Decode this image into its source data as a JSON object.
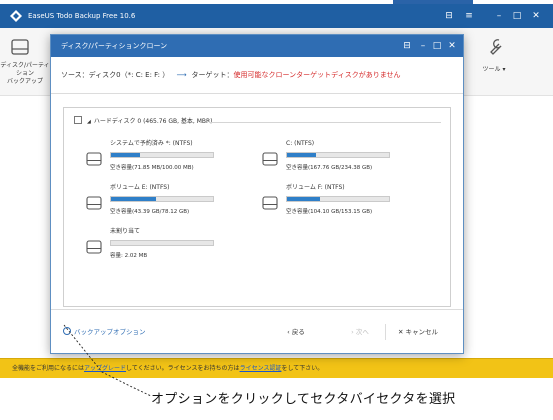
{
  "app": {
    "title": "EaseUS Todo Backup Free 10.6",
    "toolbar": {
      "clone_label": "ディスク/パーティション\nバックアップ",
      "tools_label": "ツール ▾"
    }
  },
  "dialog": {
    "title": "ディスク/パーティションクローン",
    "source_label": "ソース：",
    "source_value": "ディスク0（*: C: E: F: ）",
    "target_label": "ターゲット：",
    "target_warning": "使用可能なクローンターゲットディスクがありません",
    "disk": {
      "header": "ハードディスク 0 (465.76 GB, 基本, MBR)",
      "partitions": [
        {
          "name": "システムで予約済み *: (NTFS)",
          "size": "空き容量(71.85 MB/100.00 MB)",
          "used_fraction": 0.28
        },
        {
          "name": "C: (NTFS)",
          "size": "空き容量(167.76 GB/234.38 GB)",
          "used_fraction": 0.28
        },
        {
          "name": "ボリューム E: (NTFS)",
          "size": "空き容量(43.39 GB/78.12 GB)",
          "used_fraction": 0.44
        },
        {
          "name": "ボリューム F: (NTFS)",
          "size": "空き容量(104.10 GB/153.15 GB)",
          "used_fraction": 0.32
        },
        {
          "name": "未割り当て",
          "size": "容量: 2.02 MB",
          "used_fraction": 0
        }
      ]
    },
    "footer": {
      "options": "バックアップオプション",
      "back": "戻る",
      "next": "次へ",
      "cancel": "キャンセル"
    }
  },
  "upgrade_bar": {
    "text1": "全機能をご利用になるには",
    "link1": "アップグレード",
    "text2": "してください。ライセンスをお持ちの方は",
    "link2": "ライセンス認証",
    "text3": "をして下さい。"
  },
  "caption": "オプションをクリックしてセクタバイセクタを選択",
  "colors": {
    "title_bar": "#1f5fa3",
    "dialog_title_bar": "#2f6db3",
    "usage_fill": "#2f7fc8",
    "warning": "#d52a2a",
    "upgrade_bar": "#f2c316"
  },
  "icons": [
    "app-logo-icon",
    "disk-clone-icon",
    "tools-icon",
    "hard-drive-icon",
    "gear-icon",
    "close-icon",
    "minimize-icon",
    "maximize-icon"
  ]
}
